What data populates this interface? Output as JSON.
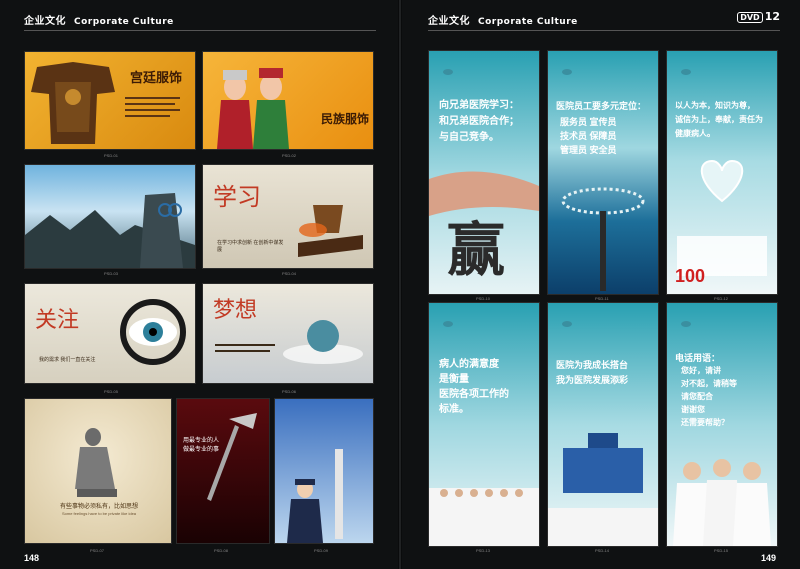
{
  "header": {
    "section_cn": "企业文化",
    "section_en": "Corporate Culture",
    "dvd_label": "DVD",
    "dvd_number": "12"
  },
  "folios": {
    "left": "148",
    "right": "149"
  },
  "left_cards": [
    {
      "id": "PSD-01",
      "title": "宫廷服饰"
    },
    {
      "id": "PSD-02",
      "title": "民族服饰"
    },
    {
      "id": "PSD-03"
    },
    {
      "id": "PSD-04",
      "title": "学习",
      "text": "在学习中求创新 在创新中谋发展"
    },
    {
      "id": "PSD-05",
      "title": "关注",
      "text": "我的需求 我们一直在关注"
    },
    {
      "id": "PSD-06",
      "title": "梦想"
    },
    {
      "id": "PSD-07",
      "text": "有些事物必须私有，比如思想",
      "text_en": "Some feelings have to be private like idea"
    },
    {
      "id": "PSD-08",
      "text": "用最专业的人 做最专业的事"
    },
    {
      "id": "PSD-09"
    }
  ],
  "right_cards": [
    {
      "id": "PSD-10",
      "lines": [
        "向兄弟医院学习：",
        "和兄弟医院合作；",
        "与自己竞争。"
      ],
      "big": "赢"
    },
    {
      "id": "PSD-11",
      "lines": [
        "医院员工要多元定位：",
        "服务员 宣传员",
        "技术员 保障员",
        "管理员 安全员"
      ]
    },
    {
      "id": "PSD-12",
      "lines": [
        "以人为本，知识为尊，",
        "诚信为上，奉献，责任为",
        "健康病人。"
      ],
      "big": "100"
    },
    {
      "id": "PSD-13",
      "lines": [
        "病人的满意度",
        "是衡量",
        "医院各项工作的",
        "标准。"
      ]
    },
    {
      "id": "PSD-14",
      "lines": [
        "医院为我成长搭台",
        "我为医院发展添彩"
      ]
    },
    {
      "id": "PSD-15",
      "lines": [
        "电话用语：",
        "您好，请讲",
        "对不起，请稍等",
        "请您配合",
        "谢谢您",
        "还需要帮助？"
      ]
    }
  ],
  "colors": {
    "bg": "#0f1112",
    "teal": "#1f8fa0",
    "gold": "#e39a17"
  }
}
